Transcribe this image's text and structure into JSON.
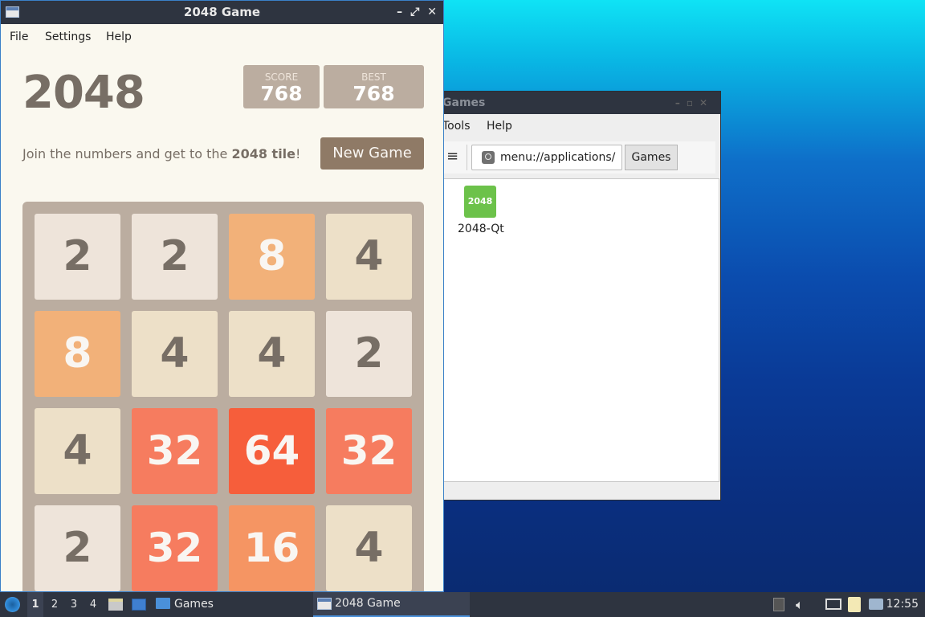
{
  "file_manager": {
    "title": "Games",
    "menu": [
      "Tools",
      "Help"
    ],
    "path": "menu://applications/",
    "breadcrumb_button": "Games",
    "app_icon_text": "2048",
    "app_label": "2048-Qt"
  },
  "game_window": {
    "title": "2048 Game",
    "controls": [
      "minimize-icon",
      "maximize-icon",
      "close-icon"
    ],
    "menu": [
      "File",
      "Settings",
      "Help"
    ],
    "game_title": "2048",
    "score_label": "SCORE",
    "score_value": "768",
    "best_label": "BEST",
    "best_value": "768",
    "intro_prefix": "Join the numbers and get to the ",
    "intro_bold": "2048 tile",
    "intro_suffix": "!",
    "new_game_label": "New Game",
    "board": [
      [
        2,
        2,
        8,
        4
      ],
      [
        8,
        4,
        4,
        2
      ],
      [
        4,
        32,
        64,
        32
      ],
      [
        2,
        32,
        16,
        4
      ]
    ],
    "tile_colors": {
      "2": {
        "bg": "#eee4da",
        "fg": "#776e65"
      },
      "4": {
        "bg": "#ede0c8",
        "fg": "#776e65"
      },
      "8": {
        "bg": "#f2b179",
        "fg": "#f9f6f2"
      },
      "16": {
        "bg": "#f59563",
        "fg": "#f9f6f2"
      },
      "32": {
        "bg": "#f67c5f",
        "fg": "#f9f6f2"
      },
      "64": {
        "bg": "#f65e3b",
        "fg": "#f9f6f2"
      }
    }
  },
  "taskbar": {
    "workspaces": [
      "1",
      "2",
      "3",
      "4"
    ],
    "active_workspace": "1",
    "tasks": [
      {
        "label": "Games",
        "icon": "folder-icon"
      },
      {
        "label": "2048 Game",
        "icon": "window-icon"
      }
    ],
    "tray_icons": [
      "tray-expand-icon",
      "volume-icon",
      "network-icon",
      "clipboard-icon",
      "notification-icon"
    ],
    "clock": "12:55"
  }
}
